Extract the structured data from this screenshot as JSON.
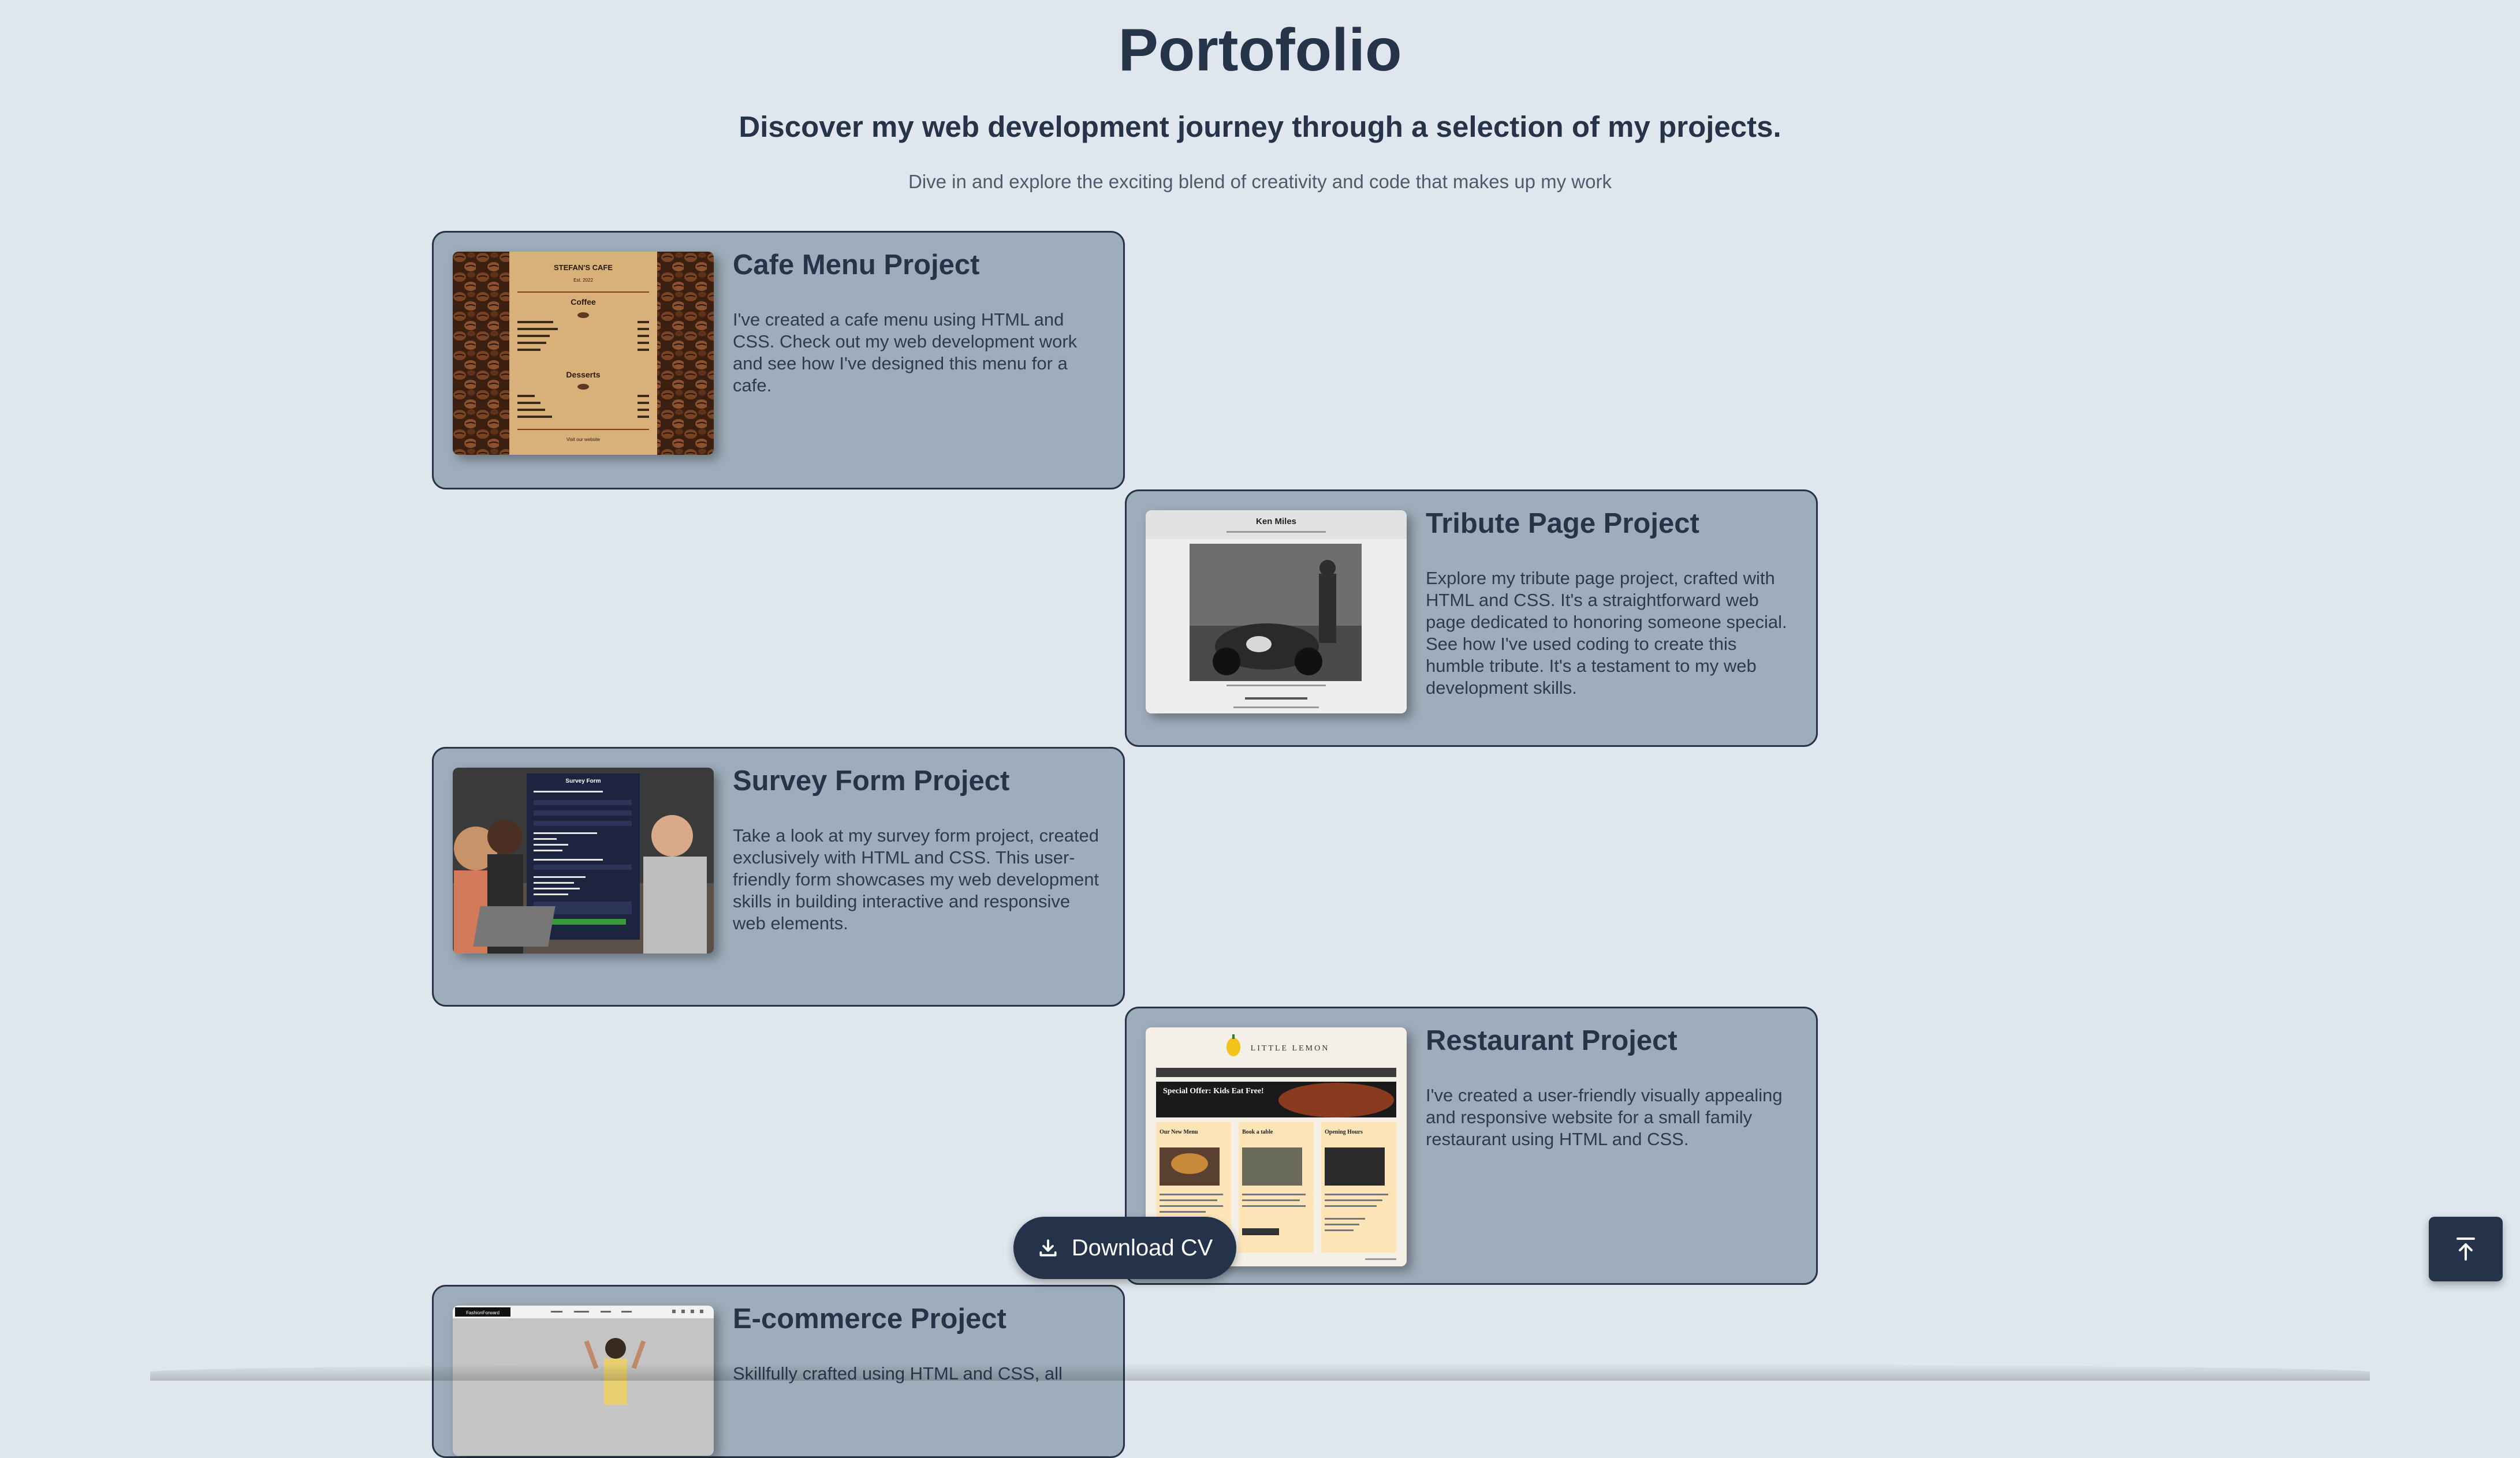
{
  "header": {
    "title": "Portofolio",
    "subtitle": "Discover my web development journey through a selection of my projects.",
    "tagline": "Dive in and explore the exciting blend of creativity and code that makes up my work"
  },
  "projects": [
    {
      "title": "Cafe Menu Project",
      "description": "I've created a cafe menu using HTML and CSS. Check out my web development work and see how I've designed this menu for a cafe.",
      "thumb": {
        "name": "STEFAN'S CAFE",
        "est": "Est. 2022",
        "section1": "Coffee",
        "section2": "Desserts",
        "footer": "Visit our website"
      }
    },
    {
      "title": "Tribute Page Project",
      "description": "Explore my tribute page project, crafted with HTML and CSS. It's a straightforward web page dedicated to honoring someone special. See how I've used coding to create this humble tribute. It's a testament to my web development skills.",
      "thumb": {
        "name": "Ken Miles"
      }
    },
    {
      "title": "Survey Form Project",
      "description": "Take a look at my survey form project, created exclusively with HTML and CSS. This user-friendly form showcases my web development skills in building interactive and responsive web elements.",
      "thumb": {
        "name": "Survey Form"
      }
    },
    {
      "title": "Restaurant Project",
      "description": "I've created a user-friendly visually appealing and responsive website for a small family restaurant using HTML and CSS.",
      "thumb": {
        "name": "LITTLE LEMON",
        "banner": "Special Offer: Kids Eat Free!",
        "col1": "Our New Menu",
        "col2": "Book a table",
        "col3": "Opening Hours"
      }
    },
    {
      "title": "E-commerce Project",
      "description": "Skillfully crafted using HTML and CSS, all",
      "thumb": {
        "name": "FashionForward"
      }
    }
  ],
  "actions": {
    "download_cv": "Download CV",
    "download_icon": "download-icon",
    "top_icon": "arrow-up-to-top-icon"
  },
  "colors": {
    "background": "#dfe6ee",
    "card": "#9eadbb",
    "accent": "#24324a"
  }
}
